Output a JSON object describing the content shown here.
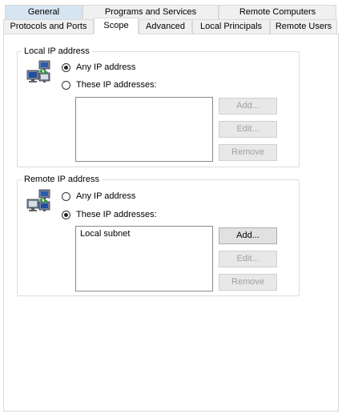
{
  "tabs": {
    "row1": [
      "General",
      "Programs and Services",
      "Remote Computers"
    ],
    "row2": [
      "Protocols and Ports",
      "Scope",
      "Advanced",
      "Local Principals",
      "Remote Users"
    ],
    "active": "Scope"
  },
  "local": {
    "title": "Local IP address",
    "any_label": "Any IP address",
    "these_label": "These IP addresses:",
    "selected": "any",
    "addresses": [],
    "add": "Add...",
    "edit": "Edit...",
    "remove": "Remove"
  },
  "remote": {
    "title": "Remote IP address",
    "any_label": "Any IP address",
    "these_label": "These IP addresses:",
    "selected": "these",
    "addresses": [
      "Local subnet"
    ],
    "add": "Add...",
    "edit": "Edit...",
    "remove": "Remove"
  },
  "icon": "network-computers-icon"
}
